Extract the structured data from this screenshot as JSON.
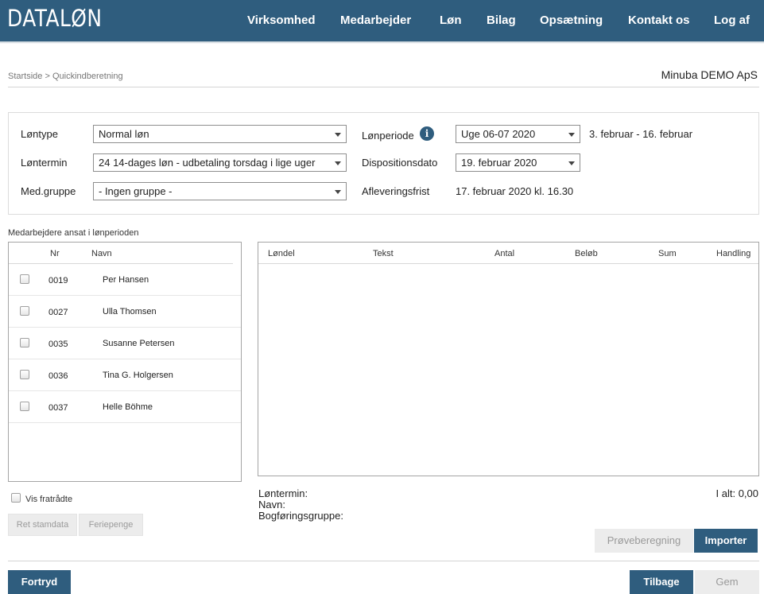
{
  "header": {
    "logo": "DATALØN",
    "nav": [
      "Virksomhed",
      "Medarbejder",
      "Løn",
      "Bilag",
      "Opsætning",
      "Kontakt os",
      "Log af"
    ]
  },
  "breadcrumb": "Startside > Quickindberetning",
  "company": "Minuba DEMO ApS",
  "form": {
    "lontype_label": "Løntype",
    "lontype_value": "Normal løn",
    "lontermin_label": "Løntermin",
    "lontermin_value": "24 14-dages løn - udbetaling torsdag i lige uger",
    "medgruppe_label": "Med.gruppe",
    "medgruppe_value": "- Ingen gruppe -",
    "lonperiode_label": "Lønperiode",
    "lonperiode_value": "Uge 06-07 2020",
    "lonperiode_range": "3. februar - 16. februar",
    "dispositionsdato_label": "Dispositionsdato",
    "dispositionsdato_value": "19. februar 2020",
    "afleveringsfrist_label": "Afleveringsfrist",
    "afleveringsfrist_value": "17. februar 2020 kl. 16.30",
    "info_glyph": "i"
  },
  "employees": {
    "caption": "Medarbejdere ansat i lønperioden",
    "col_nr": "Nr",
    "col_navn": "Navn",
    "rows": [
      {
        "nr": "0019",
        "navn": "Per Hansen"
      },
      {
        "nr": "0027",
        "navn": "Ulla Thomsen"
      },
      {
        "nr": "0035",
        "navn": "Susanne Petersen"
      },
      {
        "nr": "0036",
        "navn": "Tina G. Holgersen"
      },
      {
        "nr": "0037",
        "navn": "Helle Böhme"
      }
    ],
    "vis_fratradte": "Vis fratrådte",
    "ret_stamdata": "Ret stamdata",
    "feriepenge": "Feriepenge"
  },
  "lines": {
    "columns": [
      "Løndel",
      "Tekst",
      "Antal",
      "Beløb",
      "Sum",
      "Handling"
    ]
  },
  "summary": {
    "lontermin": "Løntermin:",
    "navn": "Navn:",
    "bogforingsgruppe": "Bogføringsgruppe:",
    "total": "I alt: 0,00"
  },
  "buttons": {
    "proveberegning": "Prøveberegning",
    "importer": "Importer",
    "fortryd": "Fortryd",
    "tilbage": "Tilbage",
    "gem": "Gem"
  },
  "colors": {
    "brand": "#2f5d7e",
    "disabled_bg": "#ececec"
  }
}
